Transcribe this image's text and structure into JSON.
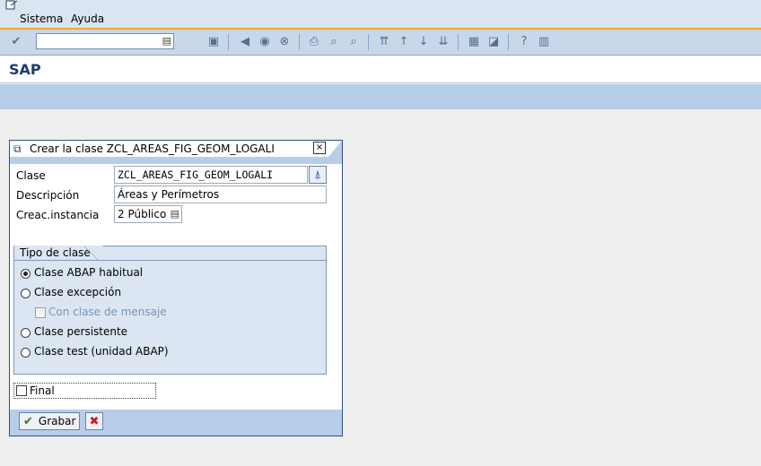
{
  "menu": {
    "items": [
      "Sistema",
      "Ayuda"
    ]
  },
  "toolbar": {
    "command_value": ""
  },
  "header": {
    "title": "SAP"
  },
  "dialog": {
    "title": "Crear la clase ZCL_AREAS_FIG_GEOM_LOGALI",
    "fields": {
      "clase_label": "Clase",
      "clase_value": "ZCL_AREAS_FIG_GEOM_LOGALI",
      "descripcion_label": "Descripción",
      "descripcion_value": "Áreas y Perímetros",
      "creac_label": "Creac.instancia",
      "creac_value": "2 Público"
    },
    "group": {
      "title": "Tipo de clase",
      "options": [
        {
          "label": "Clase ABAP habitual",
          "selected": true
        },
        {
          "label": "Clase excepción",
          "selected": false
        },
        {
          "label": "Con clase de mensaje",
          "disabled": true
        },
        {
          "label": "Clase persistente",
          "selected": false
        },
        {
          "label": "Clase test (unidad ABAP)",
          "selected": false
        }
      ]
    },
    "final_label": "Final",
    "buttons": {
      "save_label": "Grabar"
    }
  },
  "colors": {
    "menubar": "#dbe4f1",
    "toolbar": "#c8d8ea",
    "appbar": "#b7cdea",
    "accent": "#f0a830"
  },
  "icons": [
    "enter-icon",
    "save-icon",
    "back-icon",
    "exit-icon",
    "cancel-icon",
    "print-icon",
    "find-icon",
    "find-next-icon",
    "first-page-icon",
    "prev-page-icon",
    "next-page-icon",
    "last-page-icon",
    "new-session-icon",
    "shortcut-icon",
    "help-icon",
    "layout-icon"
  ]
}
